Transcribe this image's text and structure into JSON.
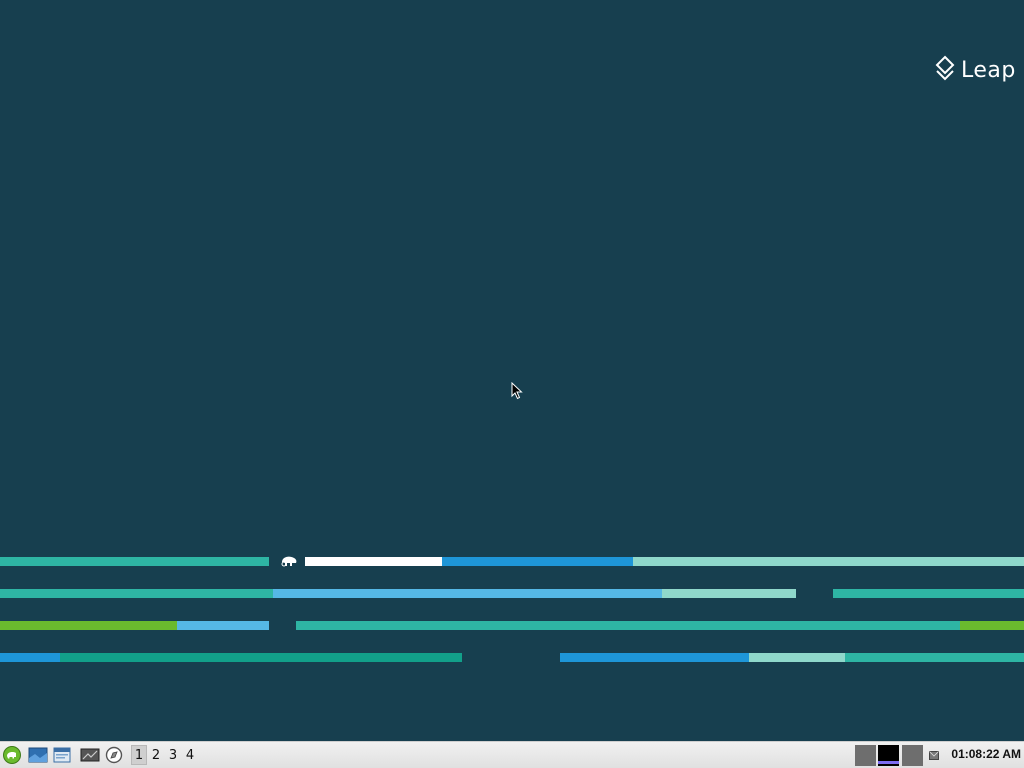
{
  "desktop": {
    "brand": {
      "text": "Leap",
      "color": "#ffffff",
      "icon": "leap-diamond-icon"
    },
    "background": "#173f4f",
    "stripe_colors": {
      "teal": "#2eb5a4",
      "blue": "#1e96d8",
      "light_blue": "#55b8e6",
      "mint": "#8fd8cb",
      "green": "#6aba2e",
      "dark_teal": "#12a08a",
      "white": "#ffffff"
    }
  },
  "taskbar": {
    "launchers": [
      {
        "name": "start-menu-icon",
        "icon": "gecko-logo"
      },
      {
        "name": "show-desktop-icon",
        "icon": "desktop"
      },
      {
        "name": "file-manager-icon",
        "icon": "folder-window"
      },
      {
        "name": "terminal-icon",
        "icon": "terminal"
      },
      {
        "name": "web-browser-icon",
        "icon": "compass"
      }
    ],
    "workspaces": [
      "1",
      "2",
      "3",
      "4"
    ],
    "active_workspace": "1",
    "clock": "01:08:22 AM"
  }
}
